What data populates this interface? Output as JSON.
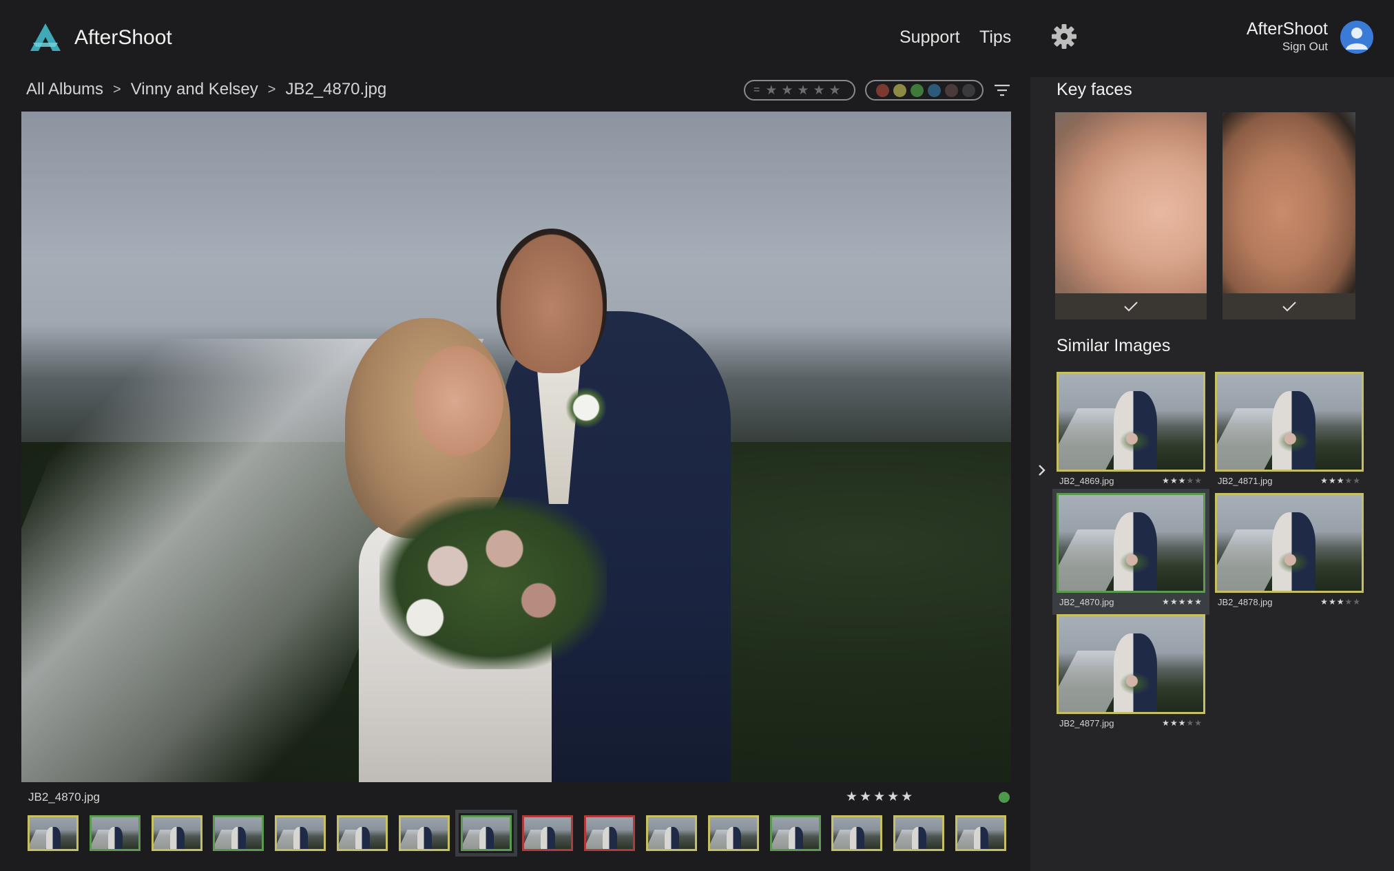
{
  "header": {
    "app_name": "AfterShoot",
    "nav": {
      "support": "Support",
      "tips": "Tips"
    },
    "account_name": "AfterShoot",
    "sign_out": "Sign Out",
    "icons": {
      "logo": "aftershoot-logo",
      "settings": "gear-icon",
      "avatar": "user-avatar-icon"
    }
  },
  "breadcrumb": {
    "items": [
      "All Albums",
      "Vinny and Kelsey",
      "JB2_4870.jpg"
    ],
    "separator": ">"
  },
  "filters": {
    "stars_prefix": "=",
    "star_count": 5,
    "colors": [
      "#7a3a32",
      "#8c8a44",
      "#3e7a3a",
      "#2e5a7a",
      "#4a3a3a",
      "#3a3a3c"
    ]
  },
  "photo": {
    "filename": "JB2_4870.jpg",
    "rating_display": "★★★★★",
    "rating": 5,
    "status_color": "#4c9a4a"
  },
  "filmstrip": {
    "thumbs": [
      {
        "border": "yellow"
      },
      {
        "border": "green"
      },
      {
        "border": "yellow"
      },
      {
        "border": "green"
      },
      {
        "border": "yellow"
      },
      {
        "border": "yellow"
      },
      {
        "border": "yellow"
      },
      {
        "border": "green",
        "active": true
      },
      {
        "border": "red"
      },
      {
        "border": "red"
      },
      {
        "border": "yellow"
      },
      {
        "border": "yellow"
      },
      {
        "border": "green"
      },
      {
        "border": "yellow"
      },
      {
        "border": "yellow"
      },
      {
        "border": "yellow"
      }
    ]
  },
  "right_panel": {
    "key_faces_title": "Key faces",
    "similar_title": "Similar Images",
    "faces": [
      {
        "checked": true
      },
      {
        "checked": true
      }
    ],
    "similar": [
      {
        "name": "JB2_4869.jpg",
        "stars": 3,
        "selected": false
      },
      {
        "name": "JB2_4871.jpg",
        "stars": 3,
        "selected": false
      },
      {
        "name": "JB2_4870.jpg",
        "stars": 5,
        "selected": true
      },
      {
        "name": "JB2_4878.jpg",
        "stars": 3,
        "selected": false
      },
      {
        "name": "JB2_4877.jpg",
        "stars": 3,
        "selected": false
      }
    ]
  }
}
